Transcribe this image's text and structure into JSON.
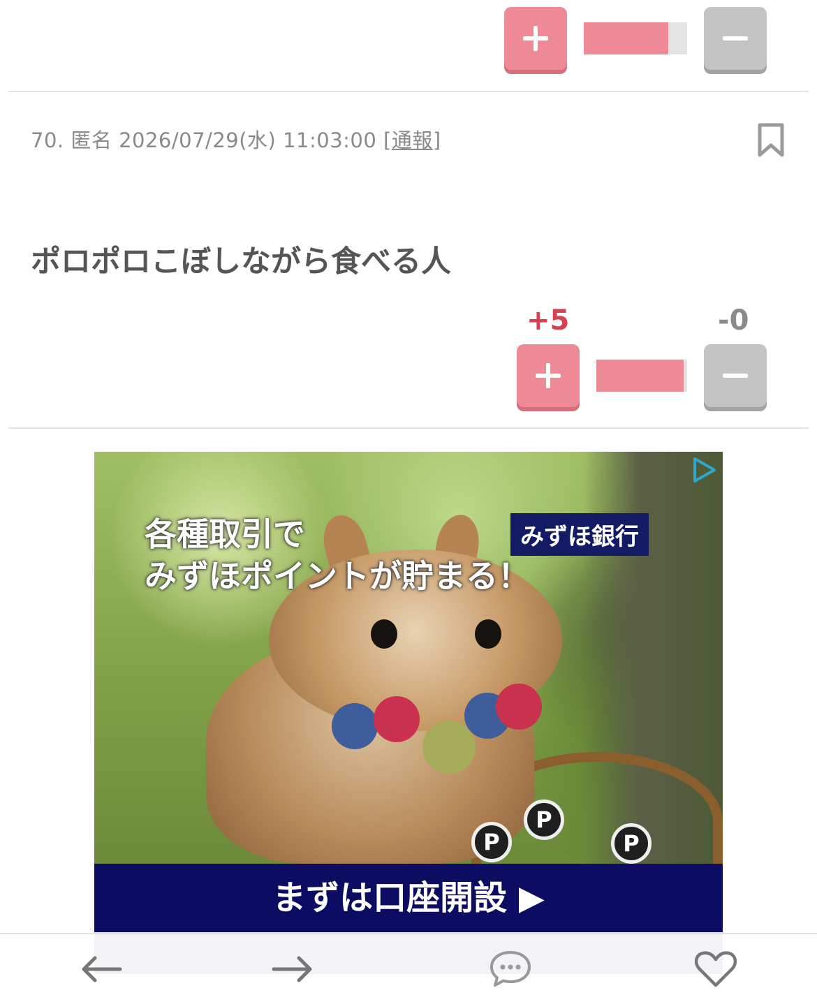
{
  "top_vote": {
    "plus_label": "+",
    "minus_label": "−",
    "plus_fraction": 0.82
  },
  "comment": {
    "number": "70.",
    "author": "匿名",
    "datetime": "2026/07/29(水) 11:03:00",
    "report_open": "[",
    "report_label": "通報",
    "report_close": "]",
    "body": "ポロポロこぼしながら食べる人",
    "score_plus": "+5",
    "score_minus": "-0",
    "plus_fraction": 0.96
  },
  "ad": {
    "headline_line1": "各種取引で",
    "headline_line2": "みずほポイントが貯まる！",
    "brand": "みずほ銀行",
    "coin_label": "P",
    "cta": "まずは口座開設 ▶"
  },
  "bottom_nav": {
    "items": [
      "back-arrow-icon",
      "forward-arrow-icon",
      "comment-bubble-icon",
      "heart-icon"
    ]
  },
  "colors": {
    "plus": "#ee8a96",
    "minus": "#c3c3c3",
    "score_plus": "#d9414f",
    "ad_cta": "#0c0c63",
    "ad_brand": "#121b63"
  }
}
